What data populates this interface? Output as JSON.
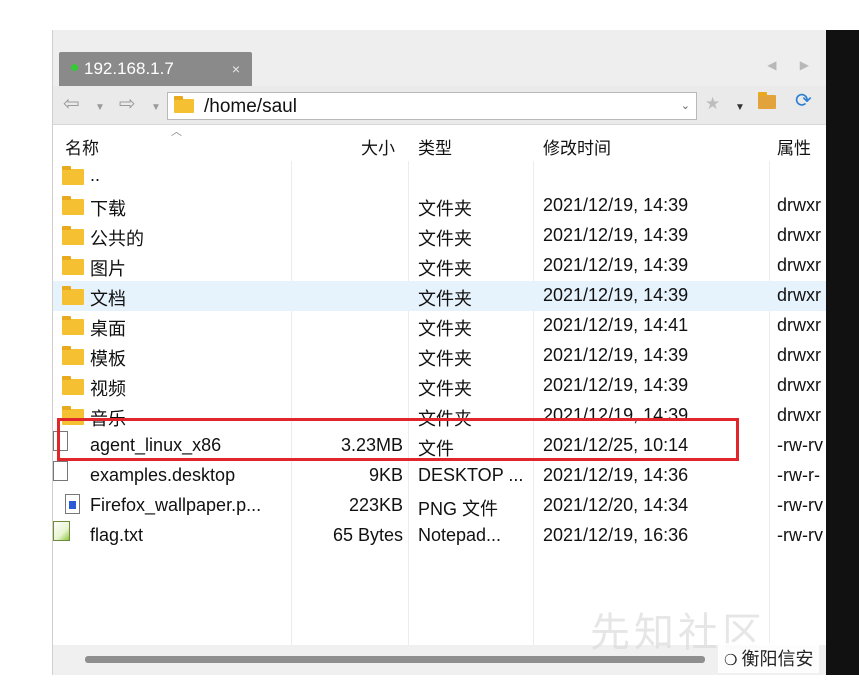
{
  "tab": {
    "title": "192.168.1.7",
    "close": "×",
    "nav": "◀ ▶"
  },
  "address": {
    "path": "/home/saul"
  },
  "columns": {
    "name": "名称",
    "size": "大小",
    "type": "类型",
    "modified": "修改时间",
    "attr": "属性"
  },
  "rows": [
    {
      "name": "..",
      "size": "",
      "type": "",
      "modified": "",
      "attr": "",
      "icon": "folder-icon"
    },
    {
      "name": "下载",
      "size": "",
      "type": "文件夹",
      "modified": "2021/12/19, 14:39",
      "attr": "drwxr",
      "icon": "folder-icon"
    },
    {
      "name": "公共的",
      "size": "",
      "type": "文件夹",
      "modified": "2021/12/19, 14:39",
      "attr": "drwxr",
      "icon": "folder-icon"
    },
    {
      "name": "图片",
      "size": "",
      "type": "文件夹",
      "modified": "2021/12/19, 14:39",
      "attr": "drwxr",
      "icon": "folder-icon"
    },
    {
      "name": "文档",
      "size": "",
      "type": "文件夹",
      "modified": "2021/12/19, 14:39",
      "attr": "drwxr",
      "icon": "folder-icon",
      "selected": true
    },
    {
      "name": "桌面",
      "size": "",
      "type": "文件夹",
      "modified": "2021/12/19, 14:41",
      "attr": "drwxr",
      "icon": "folder-icon"
    },
    {
      "name": "模板",
      "size": "",
      "type": "文件夹",
      "modified": "2021/12/19, 14:39",
      "attr": "drwxr",
      "icon": "folder-icon"
    },
    {
      "name": "视频",
      "size": "",
      "type": "文件夹",
      "modified": "2021/12/19, 14:39",
      "attr": "drwxr",
      "icon": "folder-icon"
    },
    {
      "name": "音乐",
      "size": "",
      "type": "文件夹",
      "modified": "2021/12/19, 14:39",
      "attr": "drwxr",
      "icon": "folder-icon"
    },
    {
      "name": "agent_linux_x86",
      "size": "3.23MB",
      "type": "文件",
      "modified": "2021/12/25, 10:14",
      "attr": "-rw-rv",
      "icon": "file-icon"
    },
    {
      "name": "examples.desktop",
      "size": "9KB",
      "type": "DESKTOP ...",
      "modified": "2021/12/19, 14:36",
      "attr": "-rw-r-",
      "icon": "file-icon"
    },
    {
      "name": "Firefox_wallpaper.p...",
      "size": "223KB",
      "type": "PNG 文件",
      "modified": "2021/12/20, 14:34",
      "attr": "-rw-rv",
      "icon": "png-file-icon"
    },
    {
      "name": "flag.txt",
      "size": "65 Bytes",
      "type": "Notepad...",
      "modified": "2021/12/19, 16:36",
      "attr": "-rw-rv",
      "icon": "notepad-file-icon"
    }
  ],
  "watermark": {
    "text": "衡阳信安",
    "bg_text": "先知社区"
  },
  "colors": {
    "highlight": "#e0252b",
    "selected_row": "#e6f2fc",
    "folder": "#f6c033",
    "status_dot": "#33cc33"
  }
}
